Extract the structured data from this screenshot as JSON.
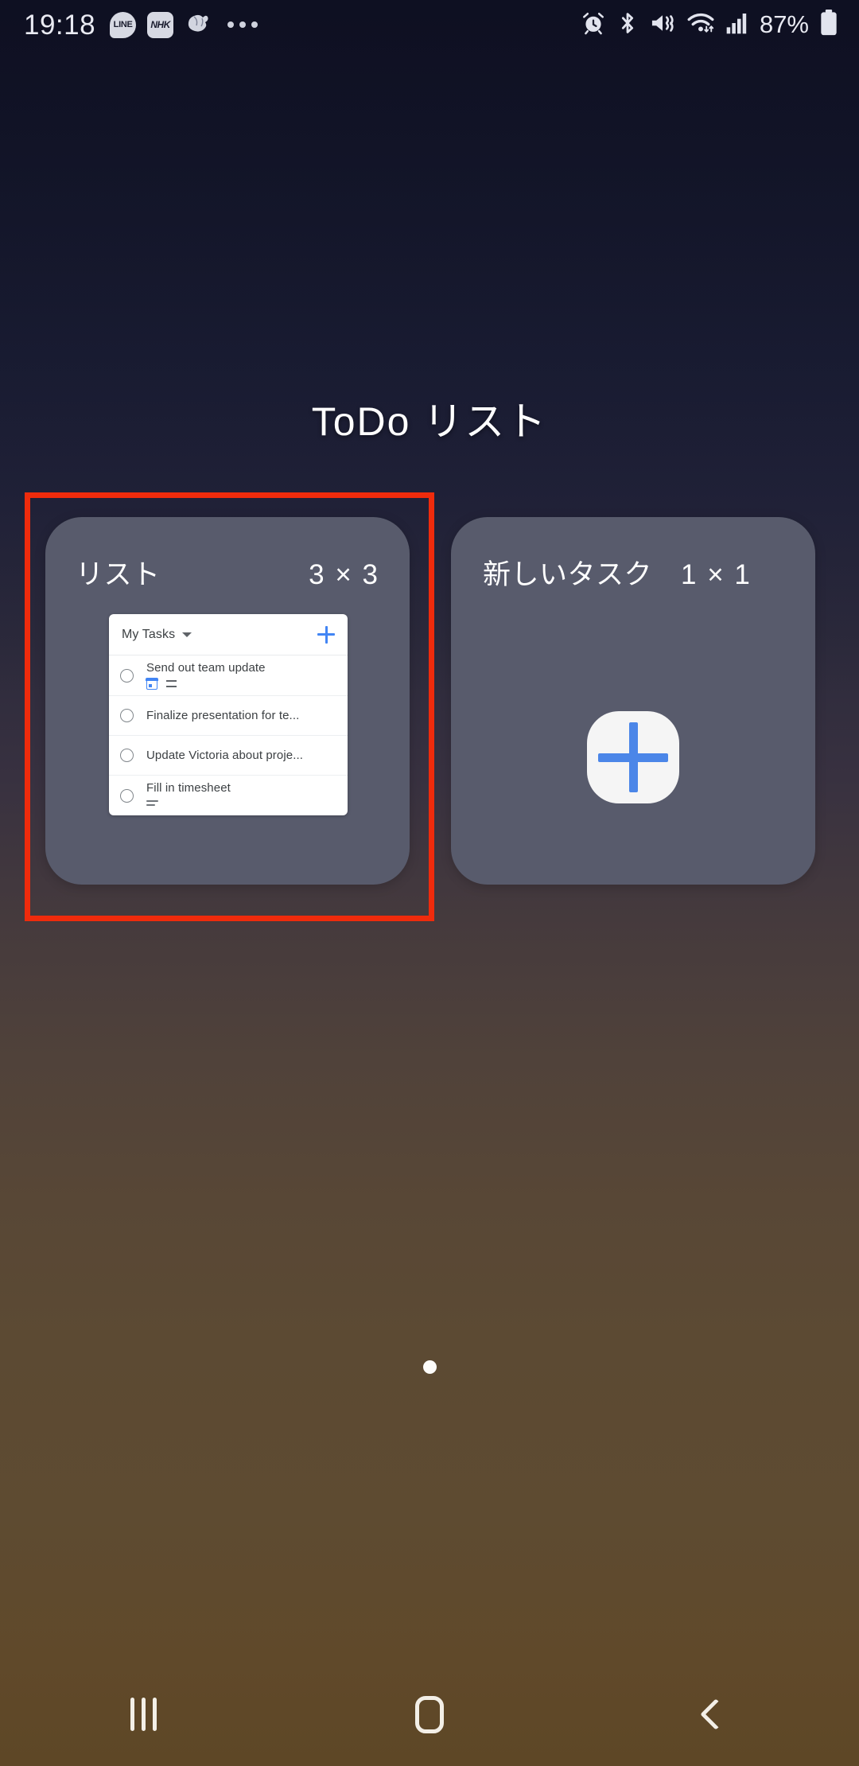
{
  "statusbar": {
    "time": "19:18",
    "notification_icons": [
      "line-app-icon",
      "nhk-app-icon",
      "app-icon",
      "more-notifications-icon"
    ],
    "system_icons": [
      "alarm-icon",
      "bluetooth-icon",
      "mute-vibrate-icon",
      "wifi-icon",
      "cellular-signal-icon"
    ],
    "battery_percent": "87%"
  },
  "page": {
    "title": "ToDo リスト",
    "page_indicator_count": 1,
    "page_indicator_active": 0
  },
  "widgets": [
    {
      "name": "リスト",
      "size": "3 × 3",
      "highlighted": true,
      "preview": {
        "list_name": "My Tasks",
        "add_label": "+",
        "tasks": [
          {
            "title": "Send out team update",
            "icons": [
              "calendar-icon",
              "repeat-icon"
            ]
          },
          {
            "title": "Finalize presentation for te...",
            "icons": []
          },
          {
            "title": "Update Victoria about proje...",
            "icons": []
          },
          {
            "title": "Fill in timesheet",
            "icons": [
              "notes-icon"
            ]
          }
        ]
      }
    },
    {
      "name": "新しいタスク",
      "size": "1 × 1",
      "highlighted": false,
      "preview": {
        "icon": "add-task-plus-icon"
      }
    }
  ],
  "navbar": {
    "recents_label": "recents-icon",
    "home_label": "home-icon",
    "back_label": "back-icon"
  },
  "colors": {
    "accent_blue": "#4285f4",
    "highlight_red": "#ef2b0c",
    "widget_card": "#585b6c"
  }
}
